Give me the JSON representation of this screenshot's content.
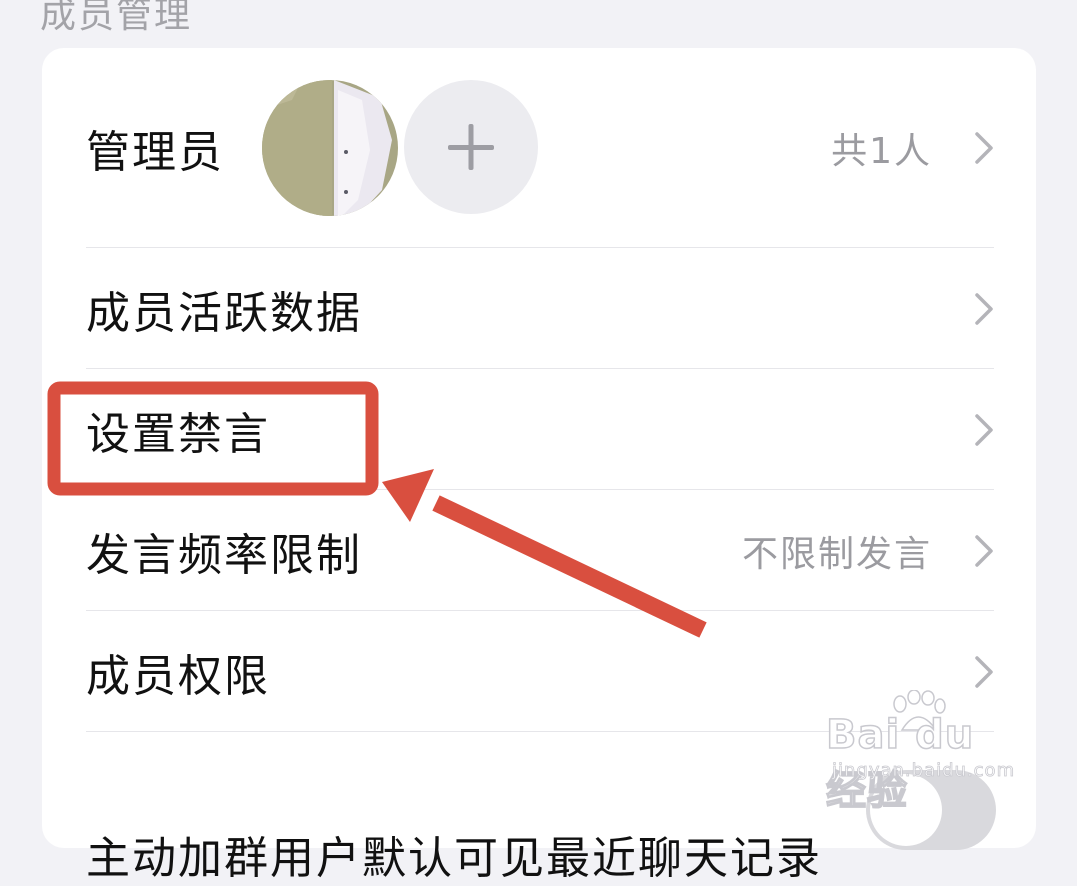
{
  "section": {
    "title": "成员管理"
  },
  "rows": {
    "admin": {
      "label": "管理员",
      "value": "共1人"
    },
    "activity": {
      "label": "成员活跃数据"
    },
    "mute": {
      "label": "设置禁言"
    },
    "frequency": {
      "label": "发言频率限制",
      "value": "不限制发言"
    },
    "permissions": {
      "label": "成员权限"
    },
    "history": {
      "label": "主动加群用户默认可见最近聊天记录"
    }
  },
  "icons": {
    "add": "plus-icon",
    "chevron": "chevron-right-icon"
  },
  "annotation": {
    "color": "#d94f3f"
  },
  "watermark": {
    "brand": "Bai du 经验",
    "url": "jingyan.baidu.com"
  },
  "colors": {
    "background": "#f2f2f6",
    "card": "#ffffff",
    "primary_text": "#111111",
    "secondary_text": "#9b9ba0"
  }
}
